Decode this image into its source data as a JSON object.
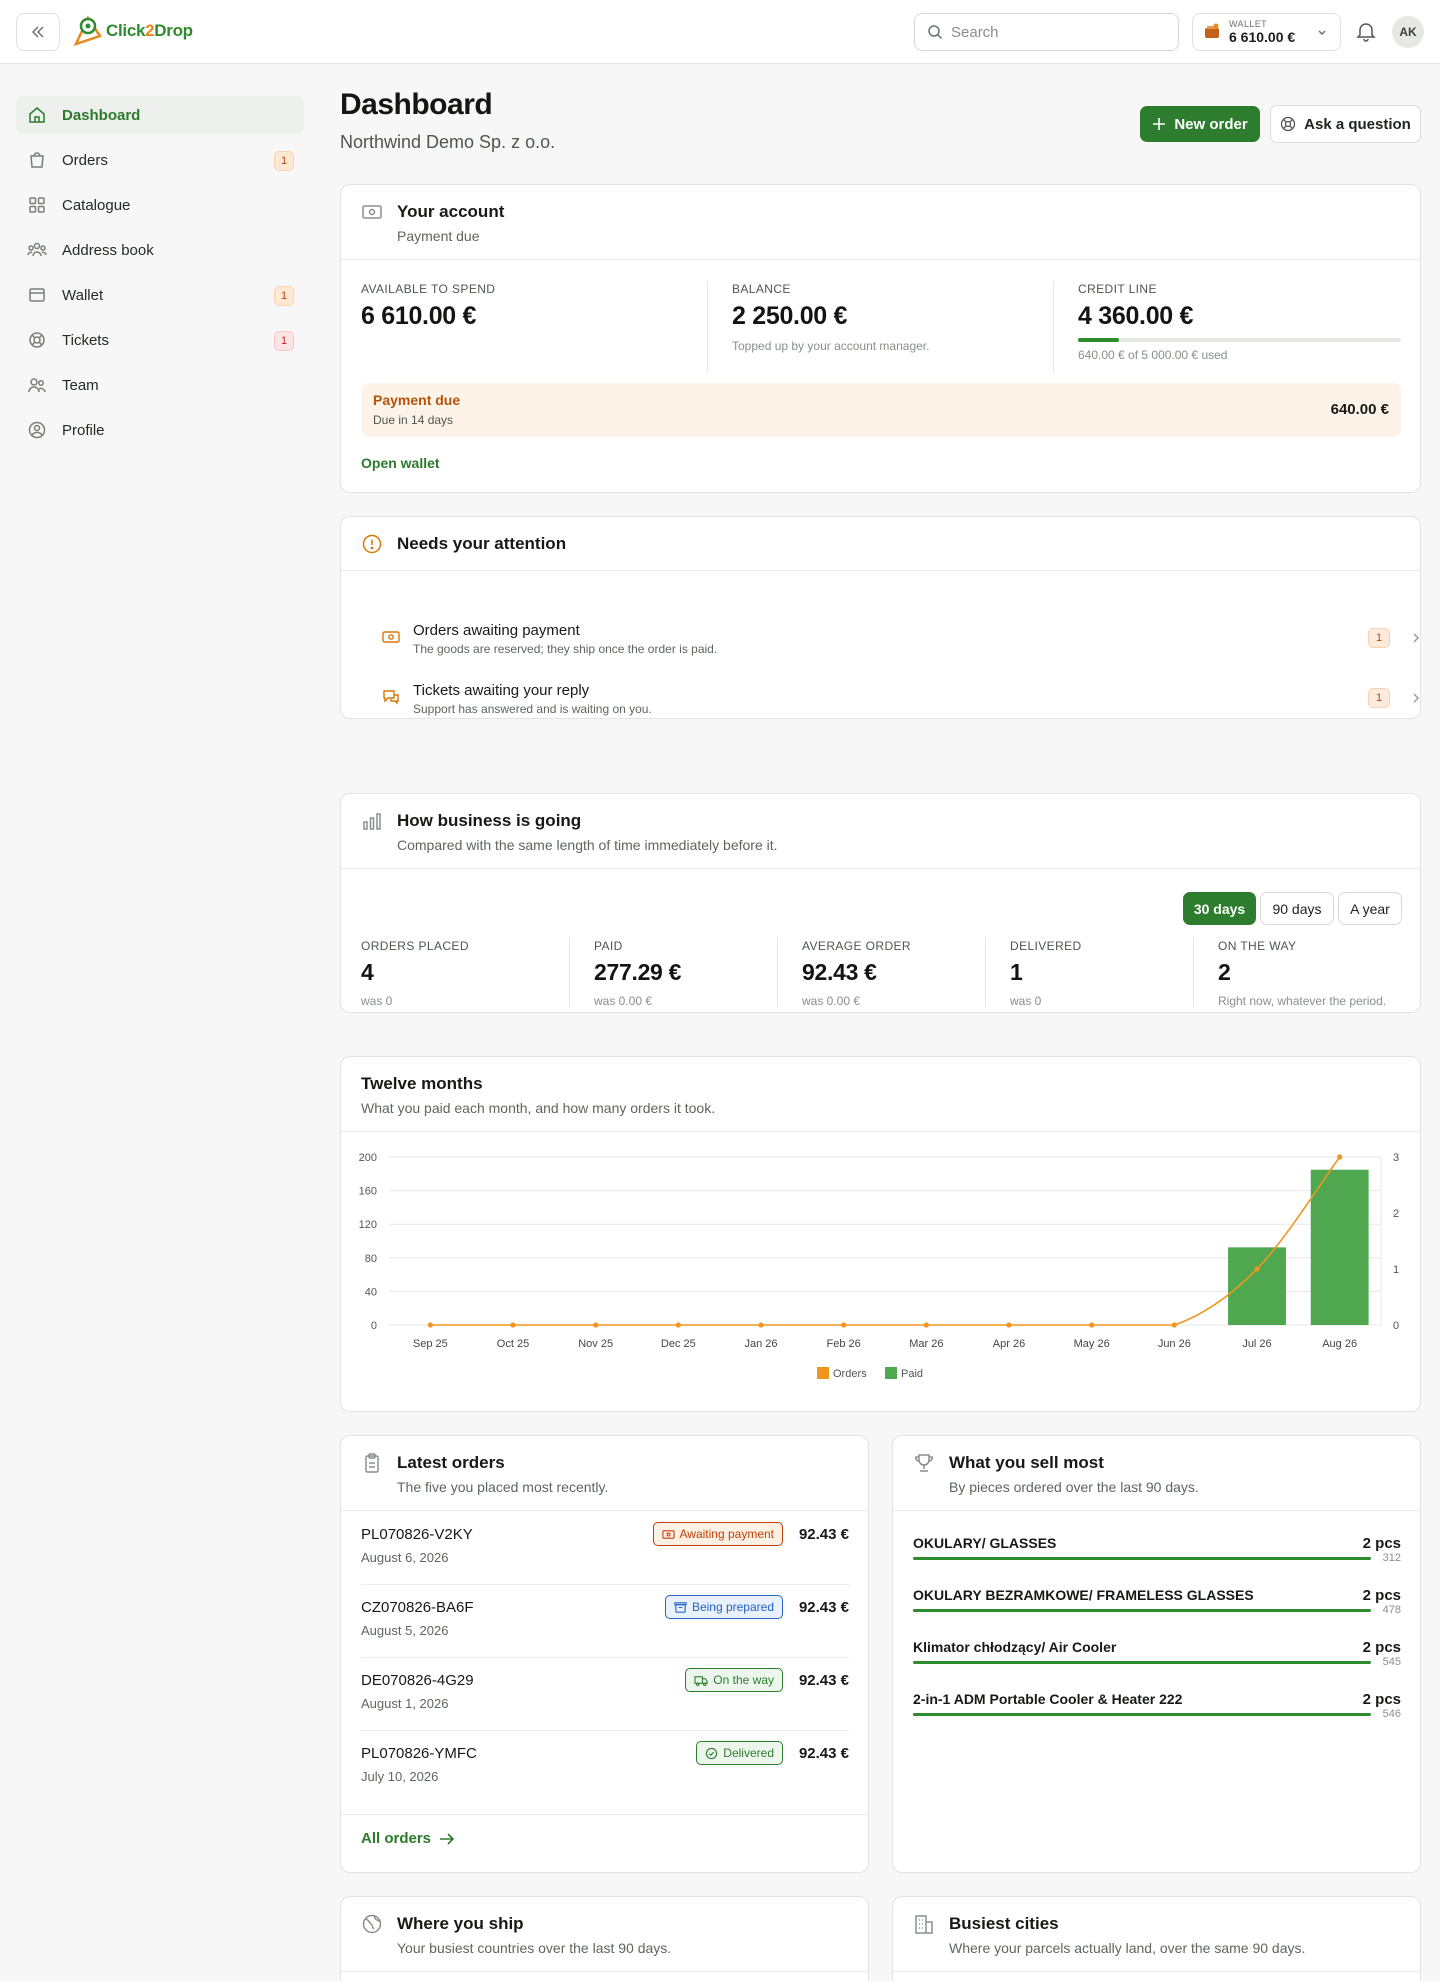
{
  "topbar": {
    "logo_text_a": "Click",
    "logo_text_b": "2",
    "logo_text_c": "Drop",
    "search_placeholder": "Search",
    "wallet_label": "WALLET",
    "wallet_value": "6 610.00 €",
    "avatar_initials": "AK"
  },
  "sidebar": {
    "items": [
      {
        "label": "Dashboard",
        "icon": "home-icon",
        "active": true
      },
      {
        "label": "Orders",
        "icon": "shopping-bag-icon",
        "badge": "1"
      },
      {
        "label": "Catalogue",
        "icon": "grid-icon"
      },
      {
        "label": "Address book",
        "icon": "users-icon"
      },
      {
        "label": "Wallet",
        "icon": "wallet-icon",
        "badge": "1"
      },
      {
        "label": "Tickets",
        "icon": "lifebuoy-icon",
        "badge": "1"
      },
      {
        "label": "Team",
        "icon": "team-icon"
      },
      {
        "label": "Profile",
        "icon": "user-circle-icon"
      }
    ]
  },
  "header": {
    "title": "Dashboard",
    "subtitle": "Northwind Demo Sp. z o.o.",
    "new_order": "New order",
    "ask_question": "Ask a question"
  },
  "account": {
    "title": "Your account",
    "subtitle": "Payment due",
    "available_label": "AVAILABLE TO SPEND",
    "available_value": "6 610.00 €",
    "balance_label": "BALANCE",
    "balance_value": "2 250.00 €",
    "balance_note": "Topped up by your account manager.",
    "credit_label": "CREDIT LINE",
    "credit_value": "4 360.00 €",
    "credit_used_fraction": 0.128,
    "credit_note": "640.00 € of 5 000.00 € used",
    "due_title": "Payment due",
    "due_sub": "Due in 14 days",
    "due_amount": "640.00 €",
    "open_wallet": "Open wallet"
  },
  "attention": {
    "title": "Needs your attention",
    "items": [
      {
        "title": "Orders awaiting payment",
        "sub": "The goods are reserved; they ship once the order is paid.",
        "count": "1"
      },
      {
        "title": "Tickets awaiting your reply",
        "sub": "Support has answered and is waiting on you.",
        "count": "1"
      }
    ]
  },
  "business": {
    "title": "How business is going",
    "subtitle": "Compared with the same length of time immediately before it.",
    "ranges": [
      "30 days",
      "90 days",
      "A year"
    ],
    "stats": [
      {
        "label": "ORDERS PLACED",
        "value": "4",
        "note": "was 0"
      },
      {
        "label": "PAID",
        "value": "277.29 €",
        "note": "was 0.00 €"
      },
      {
        "label": "AVERAGE ORDER",
        "value": "92.43 €",
        "note": "was 0.00 €"
      },
      {
        "label": "DELIVERED",
        "value": "1",
        "note": "was 0"
      },
      {
        "label": "ON THE WAY",
        "value": "2",
        "note": "Right now, whatever the period."
      }
    ]
  },
  "chart_data": {
    "type": "bar",
    "title": "Twelve months",
    "subtitle": "What you paid each month, and how many orders it took.",
    "categories": [
      "Sep 25",
      "Oct 25",
      "Nov 25",
      "Dec 25",
      "Jan 26",
      "Feb 26",
      "Mar 26",
      "Apr 26",
      "May 26",
      "Jun 26",
      "Jul 26",
      "Aug 26"
    ],
    "series": [
      {
        "name": "Orders",
        "type": "line",
        "axis": "right",
        "color": "#f0961e",
        "values": [
          0,
          0,
          0,
          0,
          0,
          0,
          0,
          0,
          0,
          0,
          1,
          3
        ]
      },
      {
        "name": "Paid",
        "type": "bar",
        "axis": "left",
        "color": "#4fa84f",
        "values": [
          0,
          0,
          0,
          0,
          0,
          0,
          0,
          0,
          0,
          0,
          92.43,
          184.86
        ]
      }
    ],
    "ylim_left": [
      0,
      200
    ],
    "yticks_left": [
      "0",
      "40",
      "80",
      "120",
      "160",
      "200"
    ],
    "ylim_right": [
      0,
      3
    ],
    "yticks_right": [
      "0",
      "1",
      "2",
      "3"
    ],
    "legend_position": "bottom-center",
    "grid": true
  },
  "latest_orders": {
    "title": "Latest orders",
    "subtitle": "The five you placed most recently.",
    "rows": [
      {
        "id": "PL070826-V2KY",
        "date": "August 6, 2026",
        "status": "Awaiting payment",
        "amount": "92.43 €"
      },
      {
        "id": "CZ070826-BA6F",
        "date": "August 5, 2026",
        "status": "Being prepared",
        "amount": "92.43 €"
      },
      {
        "id": "DE070826-4G29",
        "date": "August 1, 2026",
        "status": "On the way",
        "amount": "92.43 €"
      },
      {
        "id": "PL070826-YMFC",
        "date": "July 10, 2026",
        "status": "Delivered",
        "amount": "92.43 €"
      }
    ],
    "all_orders": "All orders"
  },
  "top_products": {
    "title": "What you sell most",
    "subtitle": "By pieces ordered over the last 90 days.",
    "rows": [
      {
        "name": "OKULARY/ GLASSES",
        "pcs": "2 pcs",
        "id": "312",
        "fraction": 1
      },
      {
        "name": "OKULARY BEZRAMKOWE/ FRAMELESS GLASSES",
        "pcs": "2 pcs",
        "id": "478",
        "fraction": 1
      },
      {
        "name": "Klimator chłodzący/ Air Cooler",
        "pcs": "2 pcs",
        "id": "545",
        "fraction": 1
      },
      {
        "name": "2-in-1 ADM Portable Cooler & Heater 222",
        "pcs": "2 pcs",
        "id": "546",
        "fraction": 1
      }
    ]
  },
  "ship": {
    "title": "Where you ship",
    "subtitle": "Your busiest countries over the last 90 days."
  },
  "cities": {
    "title": "Busiest cities",
    "subtitle": "Where your parcels actually land, over the same 90 days."
  },
  "colors": {
    "brand": "#2e7d2e",
    "accent": "#f0961e",
    "warn": "#c2410c"
  }
}
